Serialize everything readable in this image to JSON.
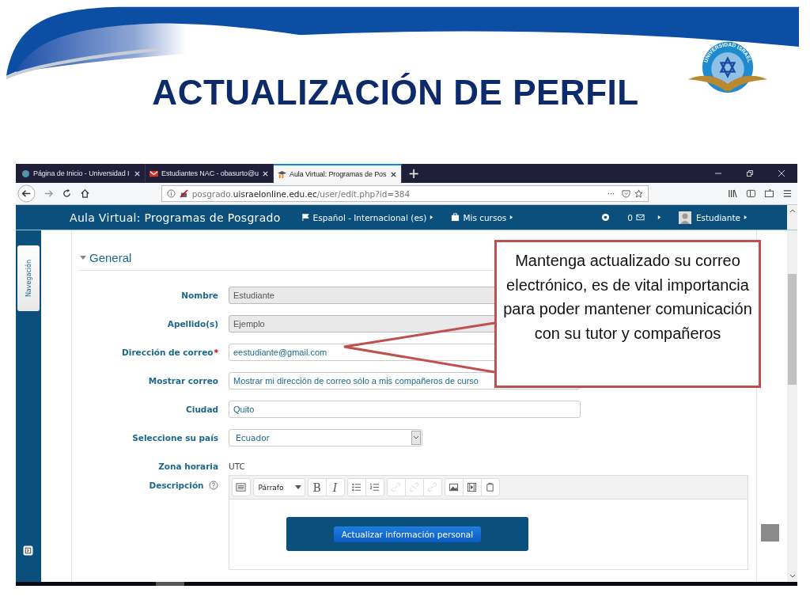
{
  "slide": {
    "title": "ACTUALIZACIÓN DE PERFIL",
    "logo_text": "UNIVERSIDAD ISRAEL"
  },
  "browser": {
    "tabs": [
      {
        "label": "Página de Inicio - Universidad I",
        "selected": false,
        "kind": "globe"
      },
      {
        "label": "Estudiantes NAC - obasurto@u",
        "selected": false,
        "kind": "mail"
      },
      {
        "label": "Aula Virtual: Programas de Pos",
        "selected": true,
        "kind": "moodle"
      }
    ],
    "new_tab": "+",
    "url": "posgrado.**uisraelonline.edu.ec**/user/edit.php?id=384",
    "more": "···"
  },
  "site": {
    "name": "Aula Virtual: Programas de Posgrado",
    "language": "Español - Internacional (es)",
    "courses": "Mis cursos",
    "messages": "0",
    "user": "Estudiante",
    "drawer": "Navegación"
  },
  "form": {
    "section": "General",
    "fields": [
      {
        "label": "Nombre",
        "value": "Estudiante",
        "kind": "text",
        "disabled": true,
        "required": false
      },
      {
        "label": "Apellido(s)",
        "value": "Ejemplo",
        "kind": "text",
        "disabled": true,
        "required": false
      },
      {
        "label": "Dirección de correo",
        "value": "eestudiante@gmail.com",
        "kind": "text",
        "disabled": false,
        "required": true
      },
      {
        "label": "Mostrar correo",
        "value": "Mostrar mi dirección de correo sólo a mis compañeros de curso",
        "kind": "text",
        "disabled": false,
        "required": false
      },
      {
        "label": "Ciudad",
        "value": "Quito",
        "kind": "text",
        "disabled": false,
        "required": false
      },
      {
        "label": "Seleccione su país",
        "value": "Ecuador",
        "kind": "select",
        "disabled": false,
        "required": false
      },
      {
        "label": "Zona horaria",
        "value": "UTC",
        "kind": "static",
        "disabled": false,
        "required": false
      }
    ],
    "required_mark": "*",
    "description_label": "Descripción"
  },
  "editor": {
    "groups": [
      [
        {
          "kind": "toggle",
          "disabled": false
        }
      ],
      [
        {
          "kind": "format",
          "label": "Párrafo"
        }
      ],
      [
        {
          "kind": "bold",
          "label": "B",
          "disabled": false
        },
        {
          "kind": "italic",
          "label": "I",
          "disabled": false
        }
      ],
      [
        {
          "kind": "bullets",
          "disabled": false
        },
        {
          "kind": "numbers",
          "disabled": false
        }
      ],
      [
        {
          "kind": "link",
          "disabled": true
        },
        {
          "kind": "unlink",
          "disabled": true
        },
        {
          "kind": "link",
          "disabled": true
        }
      ],
      [
        {
          "kind": "image",
          "disabled": false
        },
        {
          "kind": "media",
          "disabled": false
        },
        {
          "kind": "file",
          "disabled": false
        }
      ]
    ]
  },
  "update_button": "Actualizar información personal",
  "callout": "Mantenga actualizado su correo electrónico, es de vital importancia para poder mantener comunicación con su tutor y compañeros"
}
